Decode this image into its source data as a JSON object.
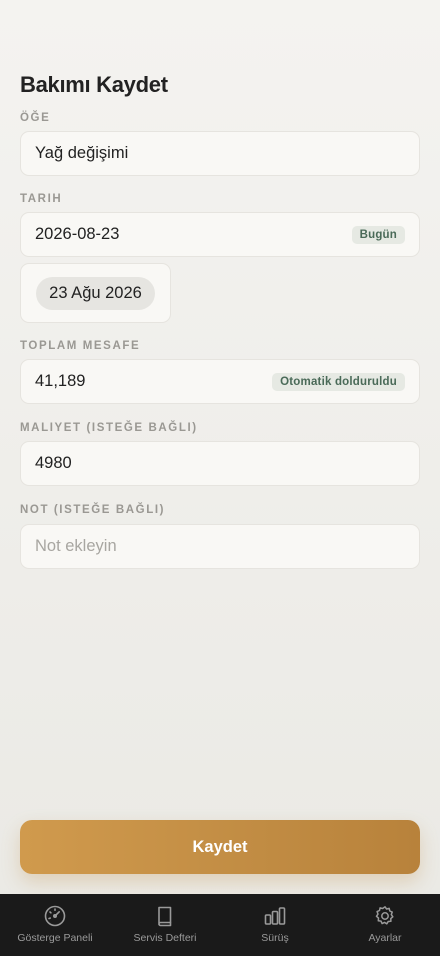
{
  "page": {
    "title": "Bakımı Kaydet"
  },
  "fields": {
    "item": {
      "label": "ÖĞE",
      "value": "Yağ değişimi"
    },
    "date": {
      "label": "TARIH",
      "value": "2026-08-23",
      "badge": "Bugün",
      "picker_value": "23 Ağu 2026"
    },
    "distance": {
      "label": "TOPLAM MESAFE",
      "value": "41,189",
      "badge": "Otomatik dolduruldu"
    },
    "cost": {
      "label": "MALIYET (ISTEĞE BAĞLI)",
      "value": "4980"
    },
    "note": {
      "label": "NOT (ISTEĞE BAĞLI)",
      "placeholder": "Not ekleyin"
    }
  },
  "actions": {
    "save_label": "Kaydet"
  },
  "tabbar": {
    "items": [
      {
        "label": "Gösterge Paneli",
        "icon": "gauge-icon"
      },
      {
        "label": "Servis Defteri",
        "icon": "book-icon"
      },
      {
        "label": "Sürüş",
        "icon": "bar-chart-icon"
      },
      {
        "label": "Ayarlar",
        "icon": "gear-icon"
      }
    ]
  },
  "colors": {
    "accent": "#c28d44",
    "badge_text": "#4a6a58",
    "tabbar_bg": "#1a1a1a"
  }
}
